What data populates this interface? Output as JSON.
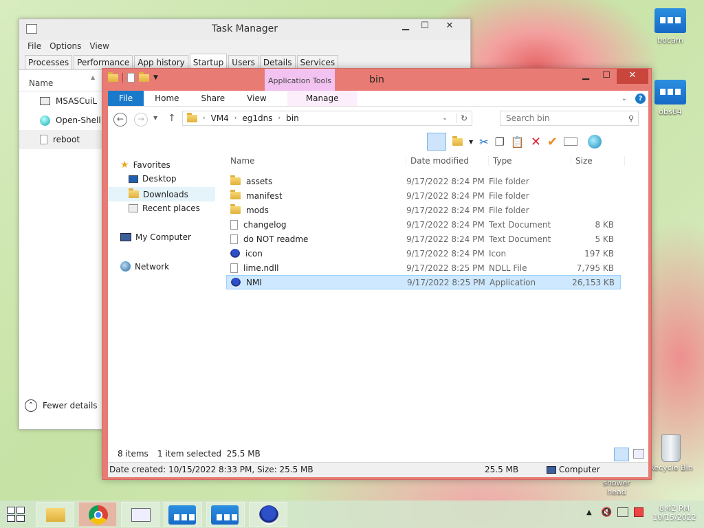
{
  "desktop": {
    "icons": [
      {
        "label": "bdcam"
      },
      {
        "label": "obs64"
      },
      {
        "label": "Recycle Bin"
      },
      {
        "label": "shower head"
      }
    ]
  },
  "task_manager": {
    "title": "Task Manager",
    "menu": [
      "File",
      "Options",
      "View"
    ],
    "tabs": [
      "Processes",
      "Performance",
      "App history",
      "Startup",
      "Users",
      "Details",
      "Services"
    ],
    "active_tab": "Startup",
    "column_name": "Name",
    "rows": [
      "MSASCuiL",
      "Open-Shell",
      "reboot"
    ],
    "fewer_details": "Fewer details"
  },
  "explorer": {
    "title": "bin",
    "context_tab": "Application Tools",
    "ribbon_tabs": [
      "File",
      "Home",
      "Share",
      "View",
      "Manage"
    ],
    "breadcrumb": [
      "VM4",
      "eg1dns",
      "bin"
    ],
    "search_placeholder": "Search bin",
    "nav": {
      "favorites": "Favorites",
      "items": [
        "Desktop",
        "Downloads",
        "Recent places"
      ],
      "my_computer": "My Computer",
      "network": "Network"
    },
    "columns": [
      "Name",
      "Date modified",
      "Type",
      "Size"
    ],
    "files": [
      {
        "name": "assets",
        "date": "9/17/2022 8:24 PM",
        "type": "File folder",
        "size": "",
        "icon": "folder"
      },
      {
        "name": "manifest",
        "date": "9/17/2022 8:24 PM",
        "type": "File folder",
        "size": "",
        "icon": "folder"
      },
      {
        "name": "mods",
        "date": "9/17/2022 8:24 PM",
        "type": "File folder",
        "size": "",
        "icon": "folder"
      },
      {
        "name": "changelog",
        "date": "9/17/2022 8:24 PM",
        "type": "Text Document",
        "size": "8 KB",
        "icon": "doc"
      },
      {
        "name": "do NOT readme",
        "date": "9/17/2022 8:24 PM",
        "type": "Text Document",
        "size": "5 KB",
        "icon": "doc"
      },
      {
        "name": "icon",
        "date": "9/17/2022 8:24 PM",
        "type": "Icon",
        "size": "197 KB",
        "icon": "app"
      },
      {
        "name": "lime.ndll",
        "date": "9/17/2022 8:25 PM",
        "type": "NDLL File",
        "size": "7,795 KB",
        "icon": "doc"
      },
      {
        "name": "NMI",
        "date": "9/17/2022 8:25 PM",
        "type": "Application",
        "size": "26,153 KB",
        "icon": "app",
        "selected": true
      }
    ],
    "status": {
      "count": "8 items",
      "selection": "1 item selected  25.5 MB"
    },
    "details": {
      "created": "Date created: 10/15/2022 8:33 PM, Size: 25.5 MB",
      "size": "25.5 MB",
      "location": "Computer"
    }
  },
  "taskbar": {
    "time": "8:42 PM",
    "date": "10/15/2022"
  }
}
